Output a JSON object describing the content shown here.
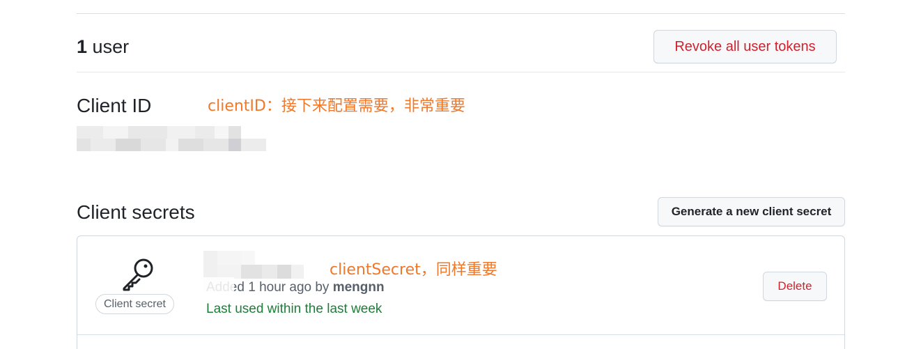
{
  "users": {
    "count": "1",
    "label": "user",
    "revoke_label": "Revoke all user tokens"
  },
  "client_id": {
    "heading": "Client ID",
    "annotation": "clientID：接下来配置需要，非常重要"
  },
  "client_secrets": {
    "heading": "Client secrets",
    "generate_label": "Generate a new client secret",
    "annotation": "clientSecret，同样重要",
    "item": {
      "badge": "Client secret",
      "added_text": "Added 1 hour ago by",
      "added_by": "mengnn",
      "last_used": "Last used within the last week",
      "delete_label": "Delete"
    }
  },
  "colors": {
    "danger": "#cf222e",
    "success": "#1a7f37",
    "annotation": "#f0782a"
  },
  "icons": {
    "secret_icon": "key-icon"
  }
}
